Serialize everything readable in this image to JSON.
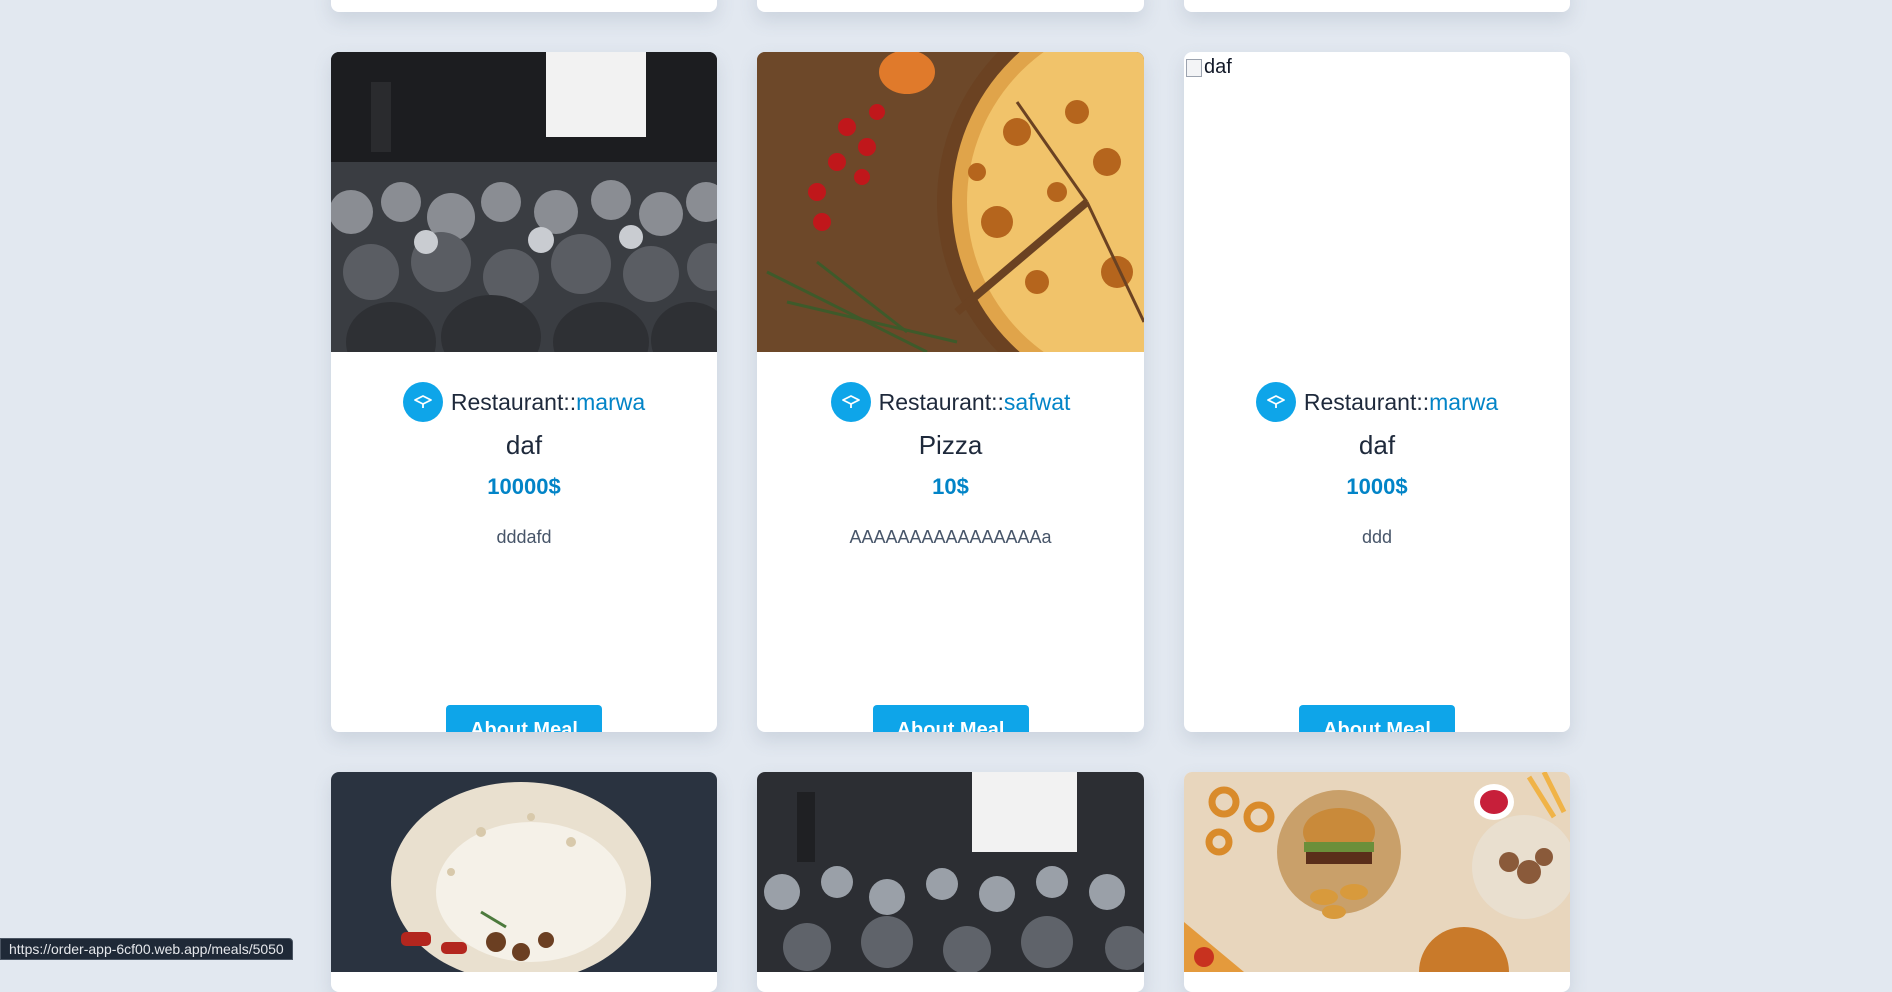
{
  "cards": [
    {
      "image_alt": "conference audience",
      "restaurant_prefix": "Restaurant::",
      "restaurant_name": "marwa",
      "meal_name": "daf",
      "price": "10000$",
      "description": "dddafd",
      "button_label": "About Meal"
    },
    {
      "image_alt": "pizza",
      "restaurant_prefix": "Restaurant::",
      "restaurant_name": "safwat",
      "meal_name": "Pizza",
      "price": "10$",
      "description": "AAAAAAAAAAAAAAAAa",
      "button_label": "About Meal"
    },
    {
      "image_alt": "daf",
      "restaurant_prefix": "Restaurant::",
      "restaurant_name": "marwa",
      "meal_name": "daf",
      "price": "1000$",
      "description": "ddd",
      "button_label": "About Meal"
    }
  ],
  "status_bar": {
    "url": "https://order-app-6cf00.web.app/meals/5050"
  },
  "colors": {
    "page_bg": "#e2e8f0",
    "accent": "#0ea5e9",
    "accent_text": "#0284c7",
    "heading_text": "#1e293b"
  },
  "icons": {
    "restaurant": "graduation-cap-icon"
  }
}
